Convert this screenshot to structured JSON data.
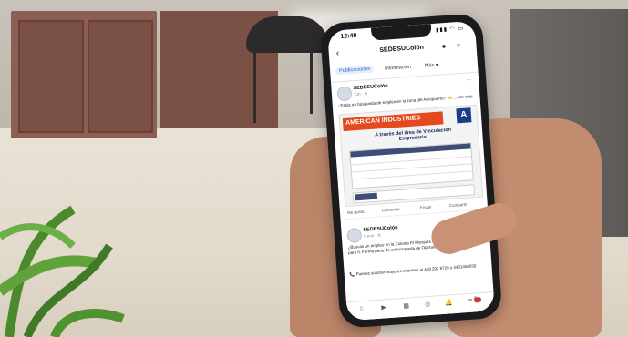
{
  "status_bar": {
    "time": "12:49",
    "icons": "▮▮▮ ◠ ▭"
  },
  "app_bar": {
    "title": "SEDESUColón",
    "back_icon": "‹",
    "messenger_icon": "●",
    "search_icon": "○"
  },
  "tabs": [
    {
      "label": "Publicaciones"
    },
    {
      "label": "Información"
    },
    {
      "label": "Más ▾"
    }
  ],
  "post1": {
    "author": "SEDESUColón",
    "meta": "13h · ⊛",
    "text": "¿Estás en búsqueda de empleo en la zona del Aeropuerto? 🙌 ... Ver más",
    "flyer_title": "AMERICAN INDUSTRIES",
    "flyer_logo": "A",
    "flyer_subtitle": "A través del área de Vinculación Empresarial"
  },
  "actions": {
    "like": "Me gusta",
    "comment": "Comentar",
    "share": "Enviar",
    "share2": "Compartir"
  },
  "post2": {
    "author": "SEDESUColón",
    "meta": "9 ene · ⊛",
    "text": "¿Buscas un empleo en la Colonia El Marqués Colón? Está oportunidad es para ti. Forma parte de en búsqueda de Operadores de producción.",
    "contact": "📞 Puedes solicitar mayores informes al 419 292 9729 y 4431456030"
  },
  "nav": {
    "home": "⌂",
    "video": "▶",
    "market": "▦",
    "profile": "◎",
    "bell": "🔔",
    "menu": "≡",
    "badge": "9+"
  }
}
